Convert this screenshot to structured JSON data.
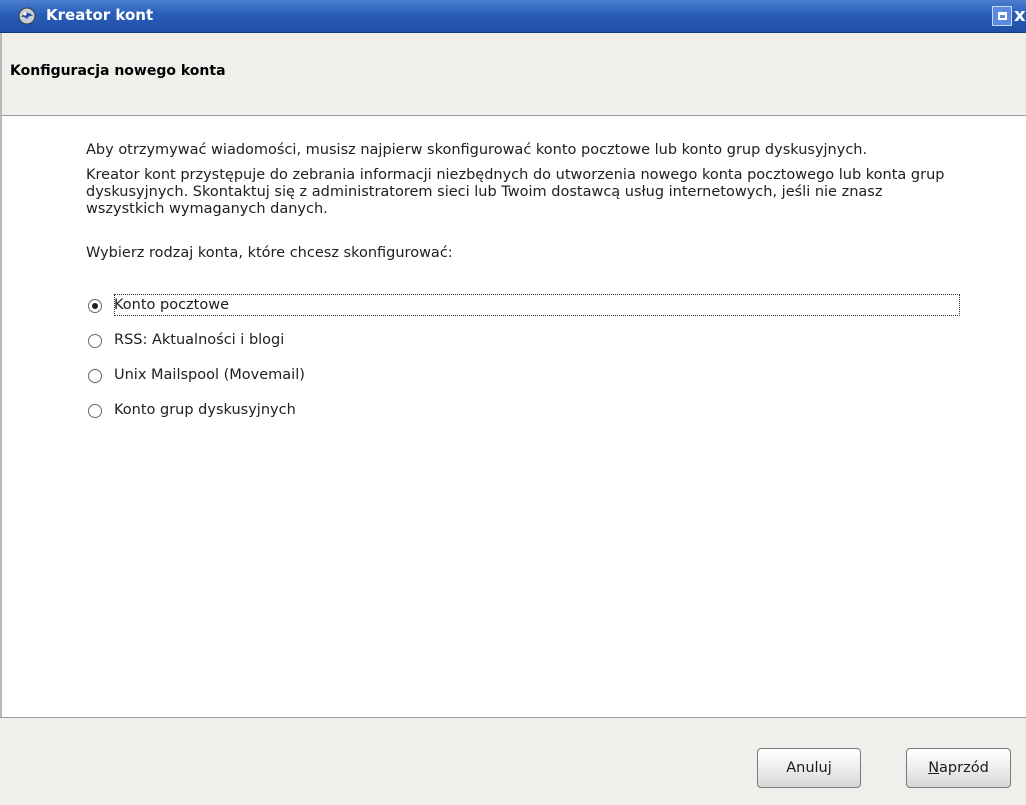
{
  "window": {
    "title": "Kreator kont",
    "close_glyph": "x"
  },
  "header": {
    "title": "Konfiguracja nowego konta"
  },
  "content": {
    "intro": "Aby otrzymywać wiadomości, musisz najpierw skonfigurować konto pocztowe lub konto grup dyskusyjnych.",
    "info_line1": "Kreator kont przystępuje do zebrania informacji niezbędnych do utworzenia nowego konta pocztowego lub konta grup",
    "info_line2": "dyskusyjnych. Skontaktuj się z administratorem sieci lub Twoim dostawcą usług internetowych, jeśli nie znasz",
    "info_line3": "wszystkich wymaganych danych.",
    "prompt": "Wybierz rodzaj konta, które chcesz skonfigurować:"
  },
  "account_types": [
    {
      "label": "Konto pocztowe",
      "checked": true
    },
    {
      "label": "RSS: Aktualności i blogi",
      "checked": false
    },
    {
      "label": "Unix Mailspool (Movemail)",
      "checked": false
    },
    {
      "label": "Konto grup dyskusyjnych",
      "checked": false
    }
  ],
  "footer": {
    "cancel_label": "Anuluj",
    "next_label_rest": "aprzód",
    "next_label_mnemonic": "N"
  },
  "colors": {
    "titlebar": "#2a5db8",
    "panel": "#f0efec"
  }
}
